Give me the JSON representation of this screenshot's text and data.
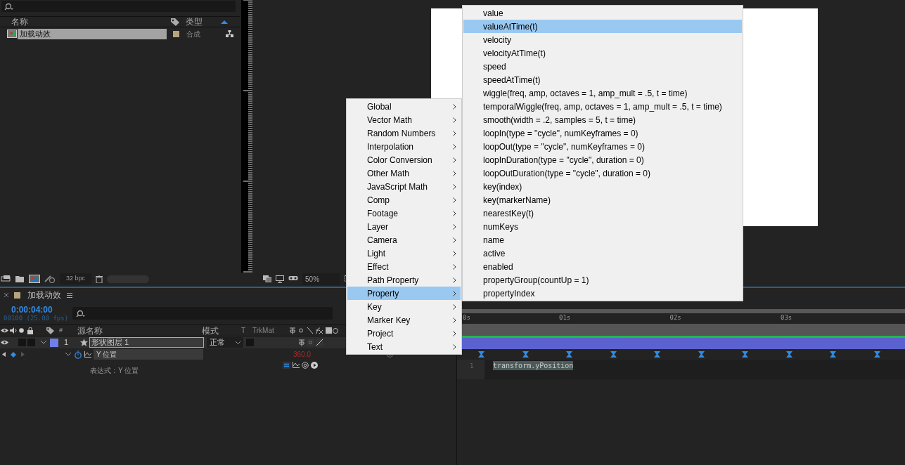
{
  "project": {
    "columns": [
      "名称",
      "类型"
    ],
    "items": [
      {
        "name": "加载动效",
        "type": "合成",
        "selected": true
      }
    ],
    "toolbar": {
      "bpc": "32 bpc"
    }
  },
  "viewer": {
    "zoom": "50%"
  },
  "timeline": {
    "tab": "加载动效",
    "timecode": "0:00:04:00",
    "frames": "00100 (25.00 fps)",
    "columns": [
      "#",
      "源名称",
      "模式",
      "T",
      "TrkMat"
    ],
    "layers": [
      {
        "number": "1",
        "name": "形状图层 1",
        "mode": "正常",
        "color": "#6f7fe6",
        "selected": true,
        "audio_on": false,
        "locked": false,
        "preserve_transparency": false
      }
    ],
    "property": {
      "name": "Y 位置",
      "value": "360.0",
      "expression_label": "表达式：Y 位置"
    },
    "ruler": [
      "0s",
      "01s",
      "02s",
      "03s"
    ],
    "expression": {
      "line": "1",
      "code": "transform.yPosition"
    }
  },
  "menu": {
    "items": [
      {
        "label": "Global",
        "selected": false
      },
      {
        "label": "Vector Math",
        "selected": false
      },
      {
        "label": "Random Numbers",
        "selected": false
      },
      {
        "label": "Interpolation",
        "selected": false
      },
      {
        "label": "Color Conversion",
        "selected": false
      },
      {
        "label": "Other Math",
        "selected": false
      },
      {
        "label": "JavaScript Math",
        "selected": false
      },
      {
        "label": "Comp",
        "selected": false
      },
      {
        "label": "Footage",
        "selected": false
      },
      {
        "label": "Layer",
        "selected": false
      },
      {
        "label": "Camera",
        "selected": false
      },
      {
        "label": "Light",
        "selected": false
      },
      {
        "label": "Effect",
        "selected": false
      },
      {
        "label": "Path Property",
        "selected": false
      },
      {
        "label": "Property",
        "selected": true
      },
      {
        "label": "Key",
        "selected": false
      },
      {
        "label": "Marker Key",
        "selected": false
      },
      {
        "label": "Project",
        "selected": false
      },
      {
        "label": "Text",
        "selected": false
      }
    ],
    "submenu": [
      {
        "label": "value",
        "selected": false
      },
      {
        "label": "valueAtTime(t)",
        "selected": true
      },
      {
        "label": "velocity",
        "selected": false
      },
      {
        "label": "velocityAtTime(t)",
        "selected": false
      },
      {
        "label": "speed",
        "selected": false
      },
      {
        "label": "speedAtTime(t)",
        "selected": false
      },
      {
        "label": "wiggle(freq, amp, octaves = 1, amp_mult = .5, t = time)",
        "selected": false
      },
      {
        "label": "temporalWiggle(freq, amp, octaves = 1, amp_mult = .5, t = time)",
        "selected": false
      },
      {
        "label": "smooth(width = .2, samples = 5, t = time)",
        "selected": false
      },
      {
        "label": "loopIn(type = \"cycle\", numKeyframes = 0)",
        "selected": false
      },
      {
        "label": "loopOut(type = \"cycle\", numKeyframes = 0)",
        "selected": false
      },
      {
        "label": "loopInDuration(type = \"cycle\", duration = 0)",
        "selected": false
      },
      {
        "label": "loopOutDuration(type = \"cycle\", duration = 0)",
        "selected": false
      },
      {
        "label": "key(index)",
        "selected": false
      },
      {
        "label": "key(markerName)",
        "selected": false
      },
      {
        "label": "nearestKey(t)",
        "selected": false
      },
      {
        "label": "numKeys",
        "selected": false
      },
      {
        "label": "name",
        "selected": false
      },
      {
        "label": "active",
        "selected": false
      },
      {
        "label": "enabled",
        "selected": false
      },
      {
        "label": "propertyGroup(countUp = 1)",
        "selected": false
      },
      {
        "label": "propertyIndex",
        "selected": false
      }
    ]
  }
}
